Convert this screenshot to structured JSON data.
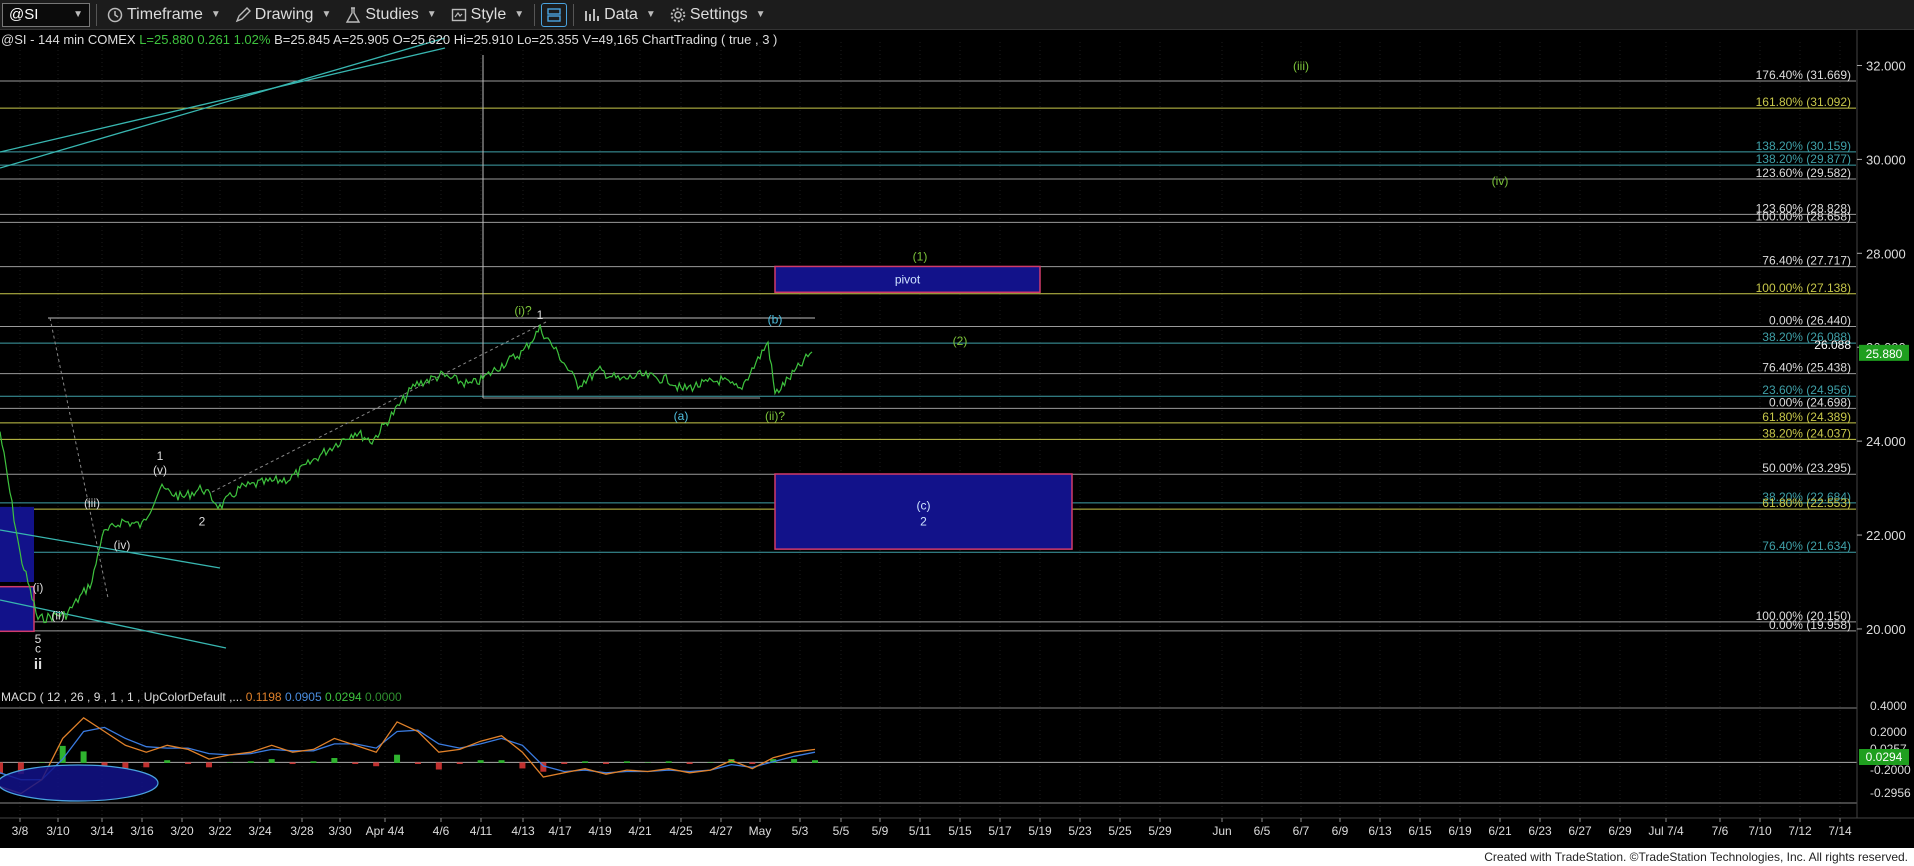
{
  "toolbar": {
    "symbol": "@SI",
    "timeframe": "Timeframe",
    "drawing": "Drawing",
    "studies": "Studies",
    "style": "Style",
    "data": "Data",
    "settings": "Settings"
  },
  "info": {
    "prefix": "@SI - 144 min  COMEX",
    "last": "L=25.880",
    "change": "0.261",
    "pct": "1.02%",
    "rest": "B=25.845  A=25.905  O=25.620  Hi=25.910  Lo=25.355  V=49,165  ChartTrading ( true , 3 )"
  },
  "macd_legend": {
    "label": "MACD ( 12 , 26 , 9 , 1 , 1 , UpColorDefault ,...",
    "v1": "0.1198",
    "v2": "0.0905",
    "v3": "0.0294",
    "v4": "0.0000"
  },
  "footer": "Created with TradeStation. ©TradeStation Technologies, Inc. All rights reserved.",
  "chart_data": {
    "type": "line",
    "title": "@SI - 144 min COMEX",
    "price_axis": {
      "ticks": [
        "32.000",
        "30.000",
        "28.000",
        "26.000",
        "24.000",
        "22.000",
        "20.000"
      ],
      "ylim": [
        18.7,
        32.5
      ]
    },
    "last_price": "25.880",
    "x_ticks": [
      "3/8",
      "3/10",
      "3/14",
      "3/16",
      "3/20",
      "3/22",
      "3/24",
      "3/28",
      "3/30",
      "Apr 4/4",
      "4/6",
      "4/11",
      "4/13",
      "4/17",
      "4/19",
      "4/21",
      "4/25",
      "4/27",
      "May",
      "5/3",
      "5/5",
      "5/9",
      "5/11",
      "5/15",
      "5/17",
      "5/19",
      "5/23",
      "5/25",
      "5/29",
      "Jun",
      "6/5",
      "6/7",
      "6/9",
      "6/13",
      "6/15",
      "6/19",
      "6/21",
      "6/23",
      "6/27",
      "6/29",
      "Jul 7/4",
      "7/6",
      "7/10",
      "7/12",
      "7/14"
    ],
    "series": [
      {
        "name": "@SI",
        "color": "#3ec23e",
        "x": [
          "3/8",
          "3/9",
          "3/10",
          "3/11",
          "3/13",
          "3/14",
          "3/15",
          "3/16",
          "3/17",
          "3/20",
          "3/21",
          "3/22",
          "3/23",
          "3/24",
          "3/27",
          "3/28",
          "3/29",
          "3/30",
          "3/31",
          "4/3",
          "4/4",
          "4/5",
          "4/6",
          "4/10",
          "4/11",
          "4/12",
          "4/13",
          "4/14",
          "4/17",
          "4/18",
          "4/19",
          "4/20",
          "4/21",
          "4/24",
          "4/25",
          "4/26",
          "4/27",
          "4/28",
          "5/1",
          "5/2",
          "5/3",
          "5/4"
        ],
        "values": [
          21.6,
          20.2,
          20.3,
          20.3,
          21.0,
          22.0,
          22.3,
          22.2,
          23.0,
          22.8,
          23.0,
          22.6,
          23.0,
          23.1,
          23.2,
          23.4,
          23.7,
          24.0,
          24.2,
          24.0,
          24.2,
          25.2,
          25.4,
          25.2,
          25.3,
          25.6,
          25.9,
          26.4,
          25.8,
          25.2,
          25.5,
          25.3,
          25.4,
          25.3,
          25.1,
          25.2,
          25.3,
          25.1,
          26.1,
          25.0,
          25.6,
          25.9
        ]
      }
    ],
    "fib_levels": [
      {
        "label": "176.40% (31.669)",
        "value": 31.669,
        "color": "#dddddd"
      },
      {
        "label": "161.80% (31.092)",
        "value": 31.092,
        "color": "#c8c84a"
      },
      {
        "label": "138.20% (30.159)",
        "value": 30.159,
        "color": "#3fa0a8"
      },
      {
        "label": "138.20% (29.877)",
        "value": 29.877,
        "color": "#3fa0a8"
      },
      {
        "label": "123.60% (29.582)",
        "value": 29.582,
        "color": "#dddddd"
      },
      {
        "label": "123.60% (28.828)",
        "value": 28.828,
        "color": "#dddddd"
      },
      {
        "label": "100.00% (28.658)",
        "value": 28.658,
        "color": "#dddddd"
      },
      {
        "label": "76.40% (27.717)",
        "value": 27.717,
        "color": "#dddddd"
      },
      {
        "label": "100.00% (27.138)",
        "value": 27.138,
        "color": "#c8c84a"
      },
      {
        "label": "0.00% (26.440)",
        "value": 26.44,
        "color": "#dddddd"
      },
      {
        "label": "38.20% (26.088)",
        "value": 26.088,
        "color": "#3fa0a8"
      },
      {
        "label": "76.40% (25.438)",
        "value": 25.438,
        "color": "#dddddd"
      },
      {
        "label": "23.60% (24.956)",
        "value": 24.956,
        "color": "#3fa0a8"
      },
      {
        "label": "0.00% (24.698)",
        "value": 24.698,
        "color": "#dddddd"
      },
      {
        "label": "61.80% (24.389)",
        "value": 24.389,
        "color": "#c8c84a"
      },
      {
        "label": "38.20% (24.037)",
        "value": 24.037,
        "color": "#c8c84a"
      },
      {
        "label": "50.00% (23.295)",
        "value": 23.295,
        "color": "#dddddd"
      },
      {
        "label": "38.20% (22.684)",
        "value": 22.684,
        "color": "#3fa0a8"
      },
      {
        "label": "61.80% (22.553)",
        "value": 22.553,
        "color": "#c8c84a"
      },
      {
        "label": "76.40% (21.634)",
        "value": 21.634,
        "color": "#3fa0a8"
      },
      {
        "label": "100.00% (20.150)",
        "value": 20.15,
        "color": "#dddddd"
      },
      {
        "label": "0.00% (19.958)",
        "value": 19.958,
        "color": "#dddddd"
      }
    ],
    "price_label_26088": "26.088",
    "boxes": [
      {
        "label": "pivot",
        "top": 27.72,
        "bottom": 27.17,
        "x_from": "5/2",
        "x_to": "5/19"
      },
      {
        "label": "(c)",
        "sub": "2",
        "top": 23.3,
        "bottom": 21.7,
        "x_from": "5/2",
        "x_to": "5/21"
      }
    ],
    "wave_labels": [
      {
        "text": "(iii)",
        "x": "6/7",
        "y": 31.9,
        "color": "#7cc43a"
      },
      {
        "text": "(iv)",
        "x": "6/21",
        "y": 29.45,
        "color": "#7cc43a"
      },
      {
        "text": "(1)",
        "x": "5/11",
        "y": 27.85,
        "color": "#7cc43a"
      },
      {
        "text": "(2)",
        "x": "5/15",
        "y": 26.05,
        "color": "#7cc43a"
      },
      {
        "text": "(i)?",
        "x": "4/13",
        "y": 26.7,
        "color": "#7cc43a"
      },
      {
        "text": "1",
        "x": "4/14",
        "y": 26.6,
        "color": "#dddddd"
      },
      {
        "text": "(b)",
        "x": "5/2",
        "y": 26.5,
        "color": "#4fc0e0"
      },
      {
        "text": "(a)",
        "x": "4/25",
        "y": 24.45,
        "color": "#4fc0e0"
      },
      {
        "text": "(ii)?",
        "x": "5/2",
        "y": 24.45,
        "color": "#7cc43a"
      },
      {
        "text": "1",
        "x": "3/17",
        "y": 23.6,
        "color": "#dddddd"
      },
      {
        "text": "(v)",
        "x": "3/17",
        "y": 23.3,
        "color": "#dddddd"
      },
      {
        "text": "(iii)",
        "x": "3/13",
        "y": 22.6,
        "color": "#dddddd"
      },
      {
        "text": "2",
        "x": "3/21",
        "y": 22.2,
        "color": "#dddddd"
      },
      {
        "text": "(iv)",
        "x": "3/15",
        "y": 21.7,
        "color": "#dddddd"
      },
      {
        "text": "(i)",
        "x": "3/9",
        "y": 20.8,
        "color": "#dddddd"
      },
      {
        "text": "(ii)",
        "x": "3/10",
        "y": 20.2,
        "color": "#dddddd"
      },
      {
        "text": "5",
        "x": "3/9",
        "y": 19.7,
        "color": "#dddddd"
      },
      {
        "text": "c",
        "x": "3/9",
        "y": 19.5,
        "color": "#dddddd"
      },
      {
        "text": "ii",
        "x": "3/9",
        "y": 19.15,
        "color": "#dddddd"
      }
    ],
    "macd": {
      "name": "MACD",
      "axis_ticks": [
        "0.4000",
        "0.2000",
        "0.0257",
        "-0.2000",
        "-0.2956"
      ],
      "last": "0.0294",
      "macd_values": [
        -0.15,
        -0.2,
        -0.1,
        0.2,
        0.35,
        0.25,
        0.15,
        0.1,
        0.15,
        0.12,
        0.05,
        0.08,
        0.1,
        0.15,
        0.1,
        0.12,
        0.2,
        0.15,
        0.1,
        0.32,
        0.25,
        0.1,
        0.12,
        0.18,
        0.22,
        0.1,
        -0.08,
        -0.05,
        -0.02,
        -0.06,
        -0.03,
        -0.04,
        -0.02,
        -0.05,
        -0.03,
        0.04,
        -0.02,
        0.06,
        0.1,
        0.12
      ],
      "signal_values": [
        -0.05,
        -0.1,
        -0.1,
        0.05,
        0.25,
        0.28,
        0.2,
        0.14,
        0.13,
        0.13,
        0.09,
        0.08,
        0.09,
        0.12,
        0.11,
        0.11,
        0.16,
        0.16,
        0.13,
        0.25,
        0.26,
        0.16,
        0.13,
        0.16,
        0.2,
        0.15,
        0.0,
        -0.04,
        -0.03,
        -0.05,
        -0.04,
        -0.04,
        -0.03,
        -0.04,
        -0.03,
        0.01,
        -0.01,
        0.03,
        0.07,
        0.1
      ],
      "ylim": [
        -0.32,
        0.45
      ]
    }
  }
}
